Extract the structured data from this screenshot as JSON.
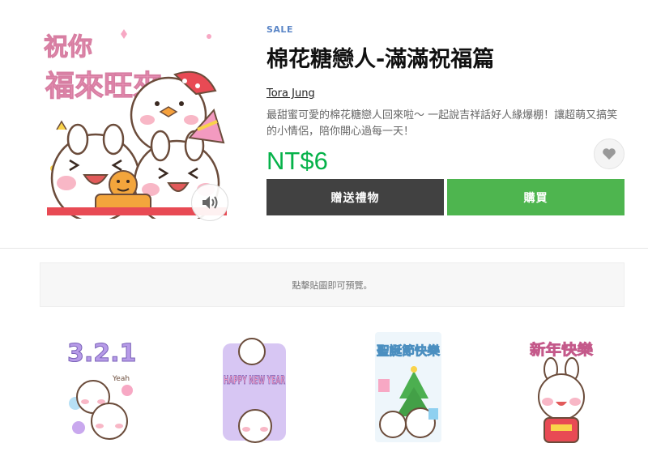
{
  "product": {
    "badge": "SALE",
    "title": "棉花糖戀人-滿滿祝福篇",
    "author": "Tora Jung",
    "description": "最甜蜜可愛的棉花糖戀人回來啦～ 一起說吉祥話好人緣爆棚！讓超萌又搞笑的小情侶，陪你開心過每一天！",
    "price": "NT$6"
  },
  "main_image": {
    "greeting_line1": "祝你",
    "greeting_line2": "福來旺來"
  },
  "buttons": {
    "gift": "贈送禮物",
    "buy": "購買"
  },
  "icons": {
    "sound": "speaker-icon",
    "favorite": "heart-icon"
  },
  "preview_hint": "點擊貼圖即可預覽。",
  "stickers": [
    {
      "name": "sticker-countdown",
      "text": "3.2.1",
      "sub": "Yeah"
    },
    {
      "name": "sticker-happy-new-year",
      "text": "HAPPY NEW YEAR"
    },
    {
      "name": "sticker-merry-christmas",
      "text": "聖誕節快樂"
    },
    {
      "name": "sticker-happy-new-year-cn",
      "text": "新年快樂"
    }
  ],
  "colors": {
    "sale": "#5b86c7",
    "price": "#06b24a",
    "buy_button": "#4eb54f",
    "gift_button": "#414141"
  }
}
